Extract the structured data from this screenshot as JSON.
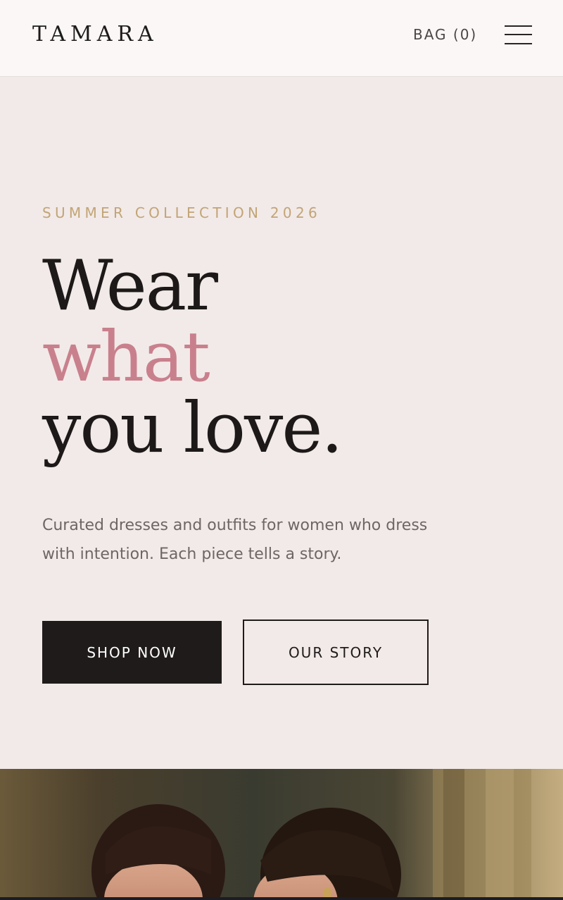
{
  "header": {
    "logo": "TAMARA",
    "bag_label": "BAG (0)"
  },
  "hero": {
    "eyebrow": "SUMMER COLLECTION 2026",
    "headline": {
      "line1": "Wear",
      "line2": "what",
      "line3": "you love."
    },
    "subtitle_line1": "Curated dresses and outfits for women who dress",
    "subtitle_line2": "with intention. Each piece tells a story.",
    "primary_button": "SHOP NOW",
    "secondary_button": "OUR STORY"
  },
  "colors": {
    "header_bg": "#faf7f6",
    "hero_bg": "#f2eae8",
    "eyebrow": "#c2a476",
    "accent": "#c9808d",
    "ink": "#1d1919",
    "muted_text": "#6e6665"
  },
  "icons": {
    "menu": "hamburger-menu-icon"
  }
}
